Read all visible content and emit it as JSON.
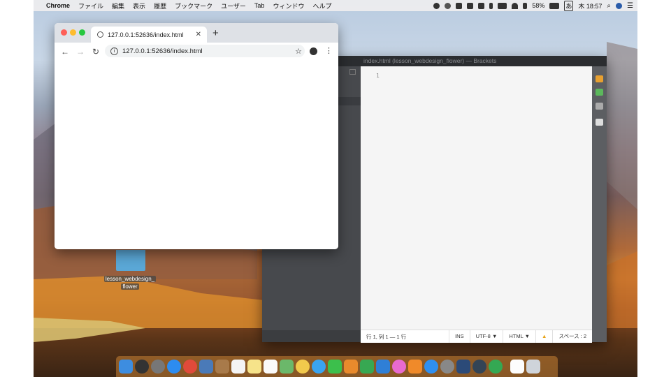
{
  "menubar": {
    "apple_icon": "apple-icon",
    "app_name": "Chrome",
    "items": [
      "ファイル",
      "編集",
      "表示",
      "履歴",
      "ブックマーク",
      "ユーザー",
      "Tab",
      "ウィンドウ",
      "ヘルプ"
    ],
    "battery": "58%",
    "input_method": "あ",
    "clock": "木 18:57"
  },
  "chrome": {
    "tab_title": "127.0.0.1:52636/index.html",
    "tab_close": "✕",
    "new_tab": "+",
    "url": "127.0.0.1:52636/index.html",
    "back": "←",
    "forward": "→",
    "reload": "↻",
    "star": "☆",
    "menu": "⋮"
  },
  "desktop": {
    "folder_label_line1": "lesson_webdesign_",
    "folder_label_line2": "flower"
  },
  "brackets": {
    "title": "index.html (lesson_webdesign_flower) — Brackets",
    "line_number": "1",
    "status": {
      "position": "行 1, 列 1 — 1 行",
      "mode": "INS",
      "encoding": "UTF-8 ▼",
      "language": "HTML ▼",
      "spaces": "スペース : 2"
    }
  },
  "colors": {
    "chrome_tabbar": "#dee1e6",
    "brackets_dark": "#3b3d40",
    "editor_bg": "#f5f5f5"
  }
}
